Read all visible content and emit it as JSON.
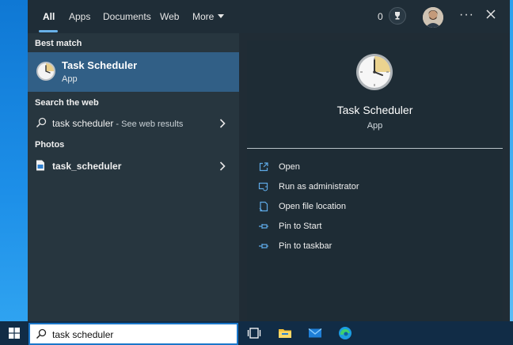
{
  "tabs": [
    {
      "label": "All",
      "active": true
    },
    {
      "label": "Apps",
      "active": false
    },
    {
      "label": "Documents",
      "active": false
    },
    {
      "label": "Web",
      "active": false
    },
    {
      "label": "More",
      "active": false
    }
  ],
  "header": {
    "rewards_points": "0",
    "trophy_icon": "trophy-icon",
    "avatar_icon": "user-avatar",
    "more_options_icon": "ellipsis-icon",
    "close_icon": "close-icon"
  },
  "results": {
    "best_match_label": "Best match",
    "best_match": {
      "title": "Task Scheduler",
      "subtitle": "App",
      "icon": "clock-icon"
    },
    "web_label": "Search the web",
    "web_result": {
      "query": "task scheduler",
      "suffix": " - See web results",
      "icon": "search-icon"
    },
    "photos_label": "Photos",
    "photo_result": {
      "name": "task_scheduler",
      "icon": "image-file-icon"
    }
  },
  "detail": {
    "title": "Task Scheduler",
    "subtitle": "App",
    "actions": [
      {
        "label": "Open",
        "icon": "open-icon"
      },
      {
        "label": "Run as administrator",
        "icon": "shield-icon"
      },
      {
        "label": "Open file location",
        "icon": "file-location-icon"
      },
      {
        "label": "Pin to Start",
        "icon": "pin-icon"
      },
      {
        "label": "Pin to taskbar",
        "icon": "pin-icon"
      }
    ]
  },
  "taskbar": {
    "search_value": "task scheduler",
    "icons": [
      "windows-start-icon",
      "task-view-icon",
      "file-explorer-icon",
      "mail-icon",
      "edge-icon"
    ]
  },
  "colors": {
    "accent": "#68b1e8",
    "selected_row": "#315f86",
    "panel_bg": "#27363f",
    "detail_bg": "#1e2c35",
    "taskbar_bg": "#112c46"
  }
}
